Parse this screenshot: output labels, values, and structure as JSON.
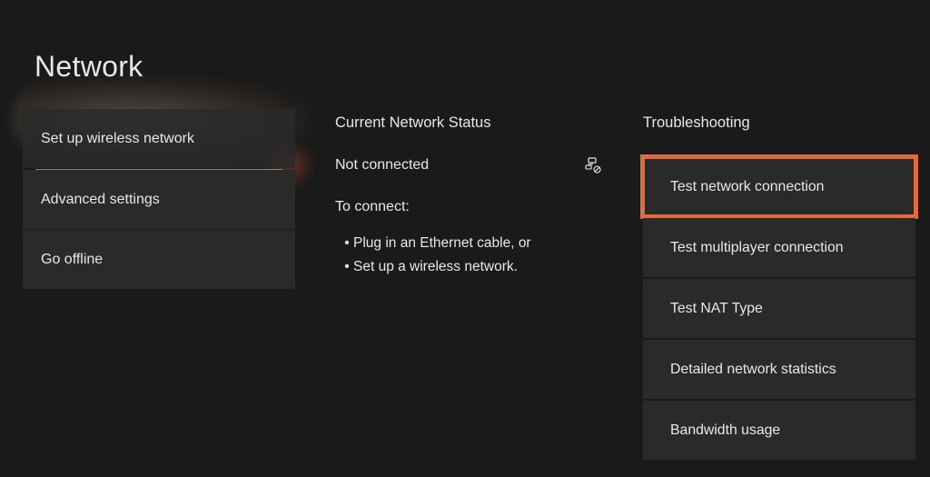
{
  "title": "Network",
  "left_menu": {
    "setup_wireless": "Set up wireless network",
    "advanced_settings": "Advanced settings",
    "go_offline": "Go offline"
  },
  "status": {
    "heading": "Current Network Status",
    "value": "Not connected",
    "to_connect_heading": "To connect:",
    "bullet_1": "Plug in an Ethernet cable, or",
    "bullet_2": "Set up a wireless network."
  },
  "troubleshooting": {
    "heading": "Troubleshooting",
    "items": {
      "test_connection": "Test network connection",
      "test_multiplayer": "Test multiplayer connection",
      "test_nat": "Test NAT Type",
      "detailed_stats": "Detailed network statistics",
      "bandwidth": "Bandwidth usage"
    }
  }
}
